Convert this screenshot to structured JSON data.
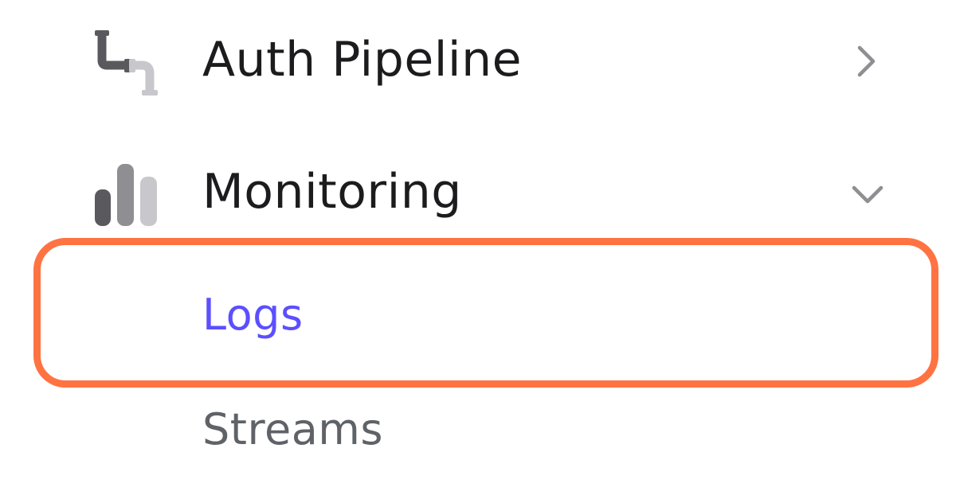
{
  "sidebar": {
    "items": [
      {
        "label": "Auth Pipeline",
        "icon": "pipeline-icon",
        "expanded": false,
        "chevron": "chevron-right-icon"
      },
      {
        "label": "Monitoring",
        "icon": "bar-chart-icon",
        "expanded": true,
        "chevron": "chevron-down-icon",
        "children": [
          {
            "label": "Logs",
            "active": true
          },
          {
            "label": "Streams",
            "active": false
          }
        ]
      }
    ]
  },
  "colors": {
    "active_text": "#5b4fff",
    "inactive_subitem": "#5f6368",
    "label_text": "#1c1c1e",
    "highlight_outline": "#ff7342",
    "icon_dark": "#5a5a5e",
    "icon_mid": "#8e8e93",
    "icon_light": "#c7c7cc",
    "chevron": "#8e8e93"
  }
}
